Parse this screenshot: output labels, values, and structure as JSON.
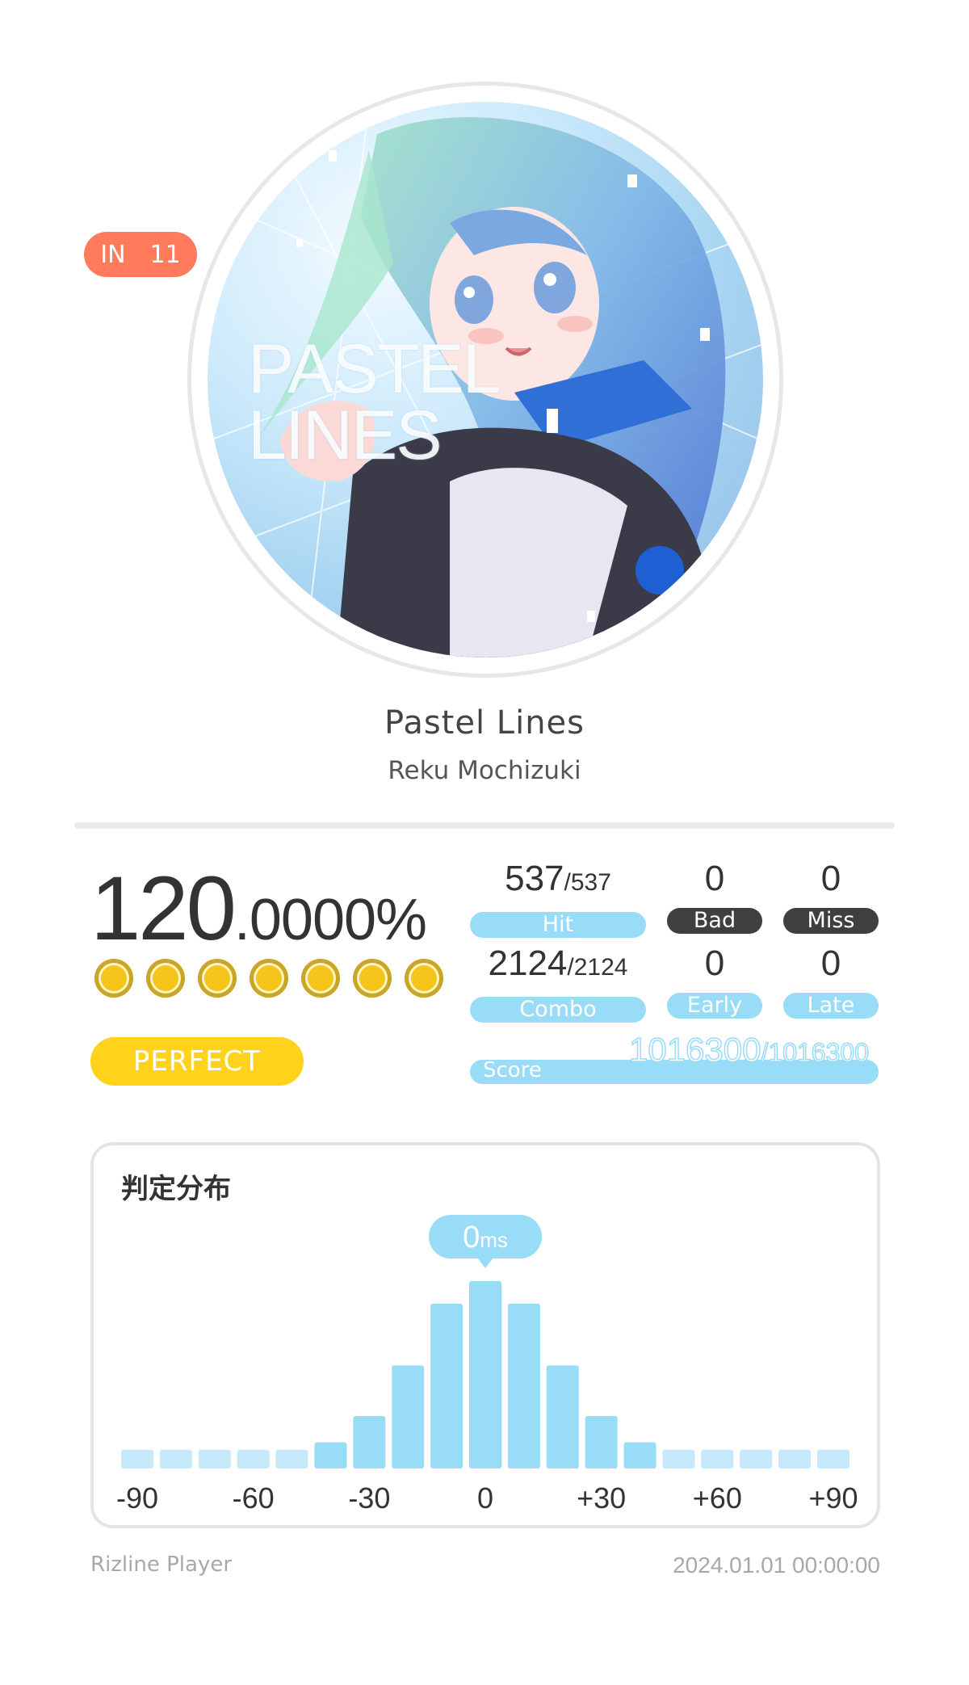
{
  "song": {
    "difficulty": "IN",
    "level": "11",
    "cover_text": "PASTEL\nLINES",
    "title": "Pastel Lines",
    "artist": "Reku Mochizuki"
  },
  "result": {
    "accuracy_int": "120",
    "accuracy_dec": ".0000%",
    "coin_count": 7,
    "rank": "PERFECT"
  },
  "stats": {
    "hit": {
      "value": "537",
      "max": "/537",
      "label": "Hit"
    },
    "bad": {
      "value": "0",
      "label": "Bad"
    },
    "miss": {
      "value": "0",
      "label": "Miss"
    },
    "combo": {
      "value": "2124",
      "max": "/2124",
      "label": "Combo"
    },
    "early": {
      "value": "0",
      "label": "Early"
    },
    "late": {
      "value": "0",
      "label": "Late"
    },
    "score": {
      "label": "Score",
      "value": "1016300",
      "max": "/1016300"
    }
  },
  "distribution": {
    "title": "判定分布",
    "center_value": "0",
    "center_unit": "ms",
    "bar_color": "#99dcf7",
    "faint_color": "#c5e9fa",
    "chart_data": {
      "type": "bar",
      "values": [
        1,
        1,
        1,
        1,
        1,
        1.4,
        2.8,
        5.5,
        8.8,
        10,
        8.8,
        5.5,
        2.8,
        1.4,
        1,
        1,
        1,
        1,
        1
      ],
      "tick_labels": [
        "-90",
        "-60",
        "-30",
        "0",
        "+30",
        "+60",
        "+90"
      ]
    }
  },
  "footer": {
    "app": "Rizline Player",
    "timestamp": "2024.01.01 00:00:00"
  },
  "colors": {
    "difficulty": "#ff7b5c",
    "rank": "#ffd21c",
    "accent": "#99dcf7",
    "dark_label": "#3f3f3f",
    "coin": "#f7c51a"
  }
}
